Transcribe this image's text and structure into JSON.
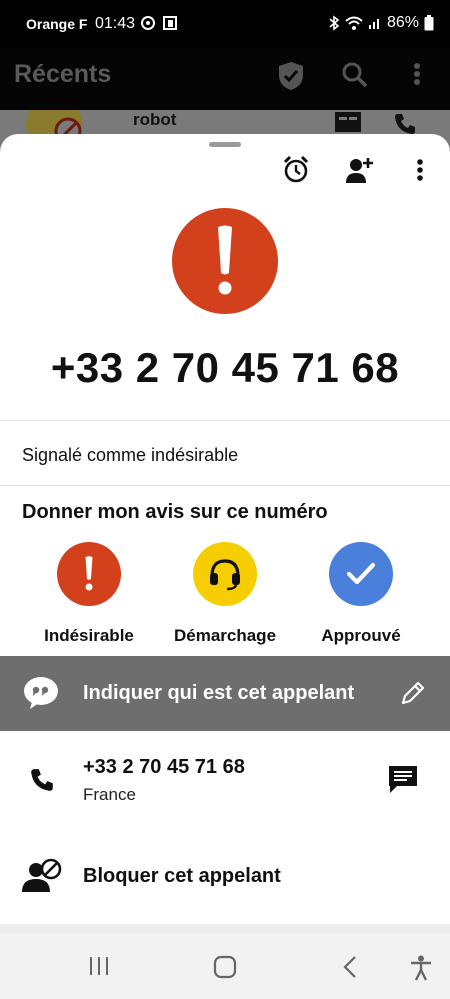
{
  "status_bar": {
    "carrier": "Orange F",
    "time": "01:43",
    "battery": "86%",
    "icons": [
      "sync-icon",
      "screenshot-icon",
      "bluetooth-icon",
      "wifi-icon",
      "signal-icon",
      "battery-icon"
    ]
  },
  "app_header": {
    "title": "Récents",
    "icons": [
      "shield-icon",
      "search-icon",
      "more-vert-icon"
    ]
  },
  "background_item": {
    "name": "robot"
  },
  "sheet": {
    "top_icons": [
      "alarm-icon",
      "add-contact-icon",
      "more-vert-icon"
    ],
    "phone_number": "+33 2 70 45 71 68",
    "spam_status": "Signalé comme indésirable",
    "feedback_title": "Donner mon avis sur ce numéro",
    "rating_options": [
      {
        "label": "Indésirable",
        "color": "#d2401c",
        "icon": "exclamation-icon"
      },
      {
        "label": "Démarchage",
        "color": "#f6cd00",
        "icon": "headset-icon"
      },
      {
        "label": "Approuvé",
        "color": "#4a7fdc",
        "icon": "check-icon"
      }
    ],
    "identify_label": "Indiquer qui est cet appelant",
    "contact": {
      "number": "+33 2 70 45 71 68",
      "country": "France"
    },
    "block_label": "Bloquer cet appelant"
  },
  "nav_bar": {
    "icons": [
      "recent-apps-icon",
      "home-icon",
      "back-icon",
      "accessibility-icon"
    ]
  }
}
